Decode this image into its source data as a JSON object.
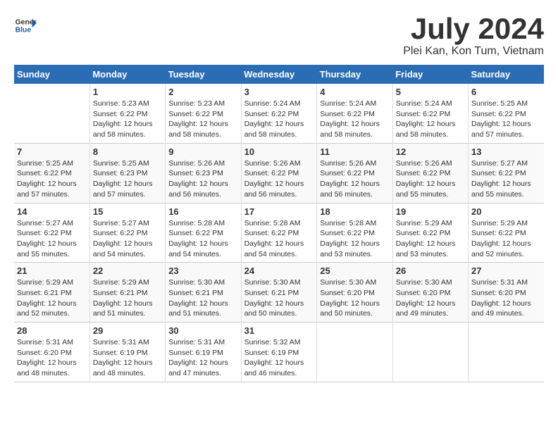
{
  "header": {
    "logo_line1": "General",
    "logo_line2": "Blue",
    "month": "July 2024",
    "location": "Plei Kan, Kon Tum, Vietnam"
  },
  "columns": [
    "Sunday",
    "Monday",
    "Tuesday",
    "Wednesday",
    "Thursday",
    "Friday",
    "Saturday"
  ],
  "weeks": [
    [
      {
        "day": "",
        "info": ""
      },
      {
        "day": "1",
        "info": "Sunrise: 5:23 AM\nSunset: 6:22 PM\nDaylight: 12 hours\nand 58 minutes."
      },
      {
        "day": "2",
        "info": "Sunrise: 5:23 AM\nSunset: 6:22 PM\nDaylight: 12 hours\nand 58 minutes."
      },
      {
        "day": "3",
        "info": "Sunrise: 5:24 AM\nSunset: 6:22 PM\nDaylight: 12 hours\nand 58 minutes."
      },
      {
        "day": "4",
        "info": "Sunrise: 5:24 AM\nSunset: 6:22 PM\nDaylight: 12 hours\nand 58 minutes."
      },
      {
        "day": "5",
        "info": "Sunrise: 5:24 AM\nSunset: 6:22 PM\nDaylight: 12 hours\nand 58 minutes."
      },
      {
        "day": "6",
        "info": "Sunrise: 5:25 AM\nSunset: 6:22 PM\nDaylight: 12 hours\nand 57 minutes."
      }
    ],
    [
      {
        "day": "7",
        "info": "Sunrise: 5:25 AM\nSunset: 6:22 PM\nDaylight: 12 hours\nand 57 minutes."
      },
      {
        "day": "8",
        "info": "Sunrise: 5:25 AM\nSunset: 6:23 PM\nDaylight: 12 hours\nand 57 minutes."
      },
      {
        "day": "9",
        "info": "Sunrise: 5:26 AM\nSunset: 6:23 PM\nDaylight: 12 hours\nand 56 minutes."
      },
      {
        "day": "10",
        "info": "Sunrise: 5:26 AM\nSunset: 6:22 PM\nDaylight: 12 hours\nand 56 minutes."
      },
      {
        "day": "11",
        "info": "Sunrise: 5:26 AM\nSunset: 6:22 PM\nDaylight: 12 hours\nand 56 minutes."
      },
      {
        "day": "12",
        "info": "Sunrise: 5:26 AM\nSunset: 6:22 PM\nDaylight: 12 hours\nand 55 minutes."
      },
      {
        "day": "13",
        "info": "Sunrise: 5:27 AM\nSunset: 6:22 PM\nDaylight: 12 hours\nand 55 minutes."
      }
    ],
    [
      {
        "day": "14",
        "info": "Sunrise: 5:27 AM\nSunset: 6:22 PM\nDaylight: 12 hours\nand 55 minutes."
      },
      {
        "day": "15",
        "info": "Sunrise: 5:27 AM\nSunset: 6:22 PM\nDaylight: 12 hours\nand 54 minutes."
      },
      {
        "day": "16",
        "info": "Sunrise: 5:28 AM\nSunset: 6:22 PM\nDaylight: 12 hours\nand 54 minutes."
      },
      {
        "day": "17",
        "info": "Sunrise: 5:28 AM\nSunset: 6:22 PM\nDaylight: 12 hours\nand 54 minutes."
      },
      {
        "day": "18",
        "info": "Sunrise: 5:28 AM\nSunset: 6:22 PM\nDaylight: 12 hours\nand 53 minutes."
      },
      {
        "day": "19",
        "info": "Sunrise: 5:29 AM\nSunset: 6:22 PM\nDaylight: 12 hours\nand 53 minutes."
      },
      {
        "day": "20",
        "info": "Sunrise: 5:29 AM\nSunset: 6:22 PM\nDaylight: 12 hours\nand 52 minutes."
      }
    ],
    [
      {
        "day": "21",
        "info": "Sunrise: 5:29 AM\nSunset: 6:21 PM\nDaylight: 12 hours\nand 52 minutes."
      },
      {
        "day": "22",
        "info": "Sunrise: 5:29 AM\nSunset: 6:21 PM\nDaylight: 12 hours\nand 51 minutes."
      },
      {
        "day": "23",
        "info": "Sunrise: 5:30 AM\nSunset: 6:21 PM\nDaylight: 12 hours\nand 51 minutes."
      },
      {
        "day": "24",
        "info": "Sunrise: 5:30 AM\nSunset: 6:21 PM\nDaylight: 12 hours\nand 50 minutes."
      },
      {
        "day": "25",
        "info": "Sunrise: 5:30 AM\nSunset: 6:20 PM\nDaylight: 12 hours\nand 50 minutes."
      },
      {
        "day": "26",
        "info": "Sunrise: 5:30 AM\nSunset: 6:20 PM\nDaylight: 12 hours\nand 49 minutes."
      },
      {
        "day": "27",
        "info": "Sunrise: 5:31 AM\nSunset: 6:20 PM\nDaylight: 12 hours\nand 49 minutes."
      }
    ],
    [
      {
        "day": "28",
        "info": "Sunrise: 5:31 AM\nSunset: 6:20 PM\nDaylight: 12 hours\nand 48 minutes."
      },
      {
        "day": "29",
        "info": "Sunrise: 5:31 AM\nSunset: 6:19 PM\nDaylight: 12 hours\nand 48 minutes."
      },
      {
        "day": "30",
        "info": "Sunrise: 5:31 AM\nSunset: 6:19 PM\nDaylight: 12 hours\nand 47 minutes."
      },
      {
        "day": "31",
        "info": "Sunrise: 5:32 AM\nSunset: 6:19 PM\nDaylight: 12 hours\nand 46 minutes."
      },
      {
        "day": "",
        "info": ""
      },
      {
        "day": "",
        "info": ""
      },
      {
        "day": "",
        "info": ""
      }
    ]
  ]
}
